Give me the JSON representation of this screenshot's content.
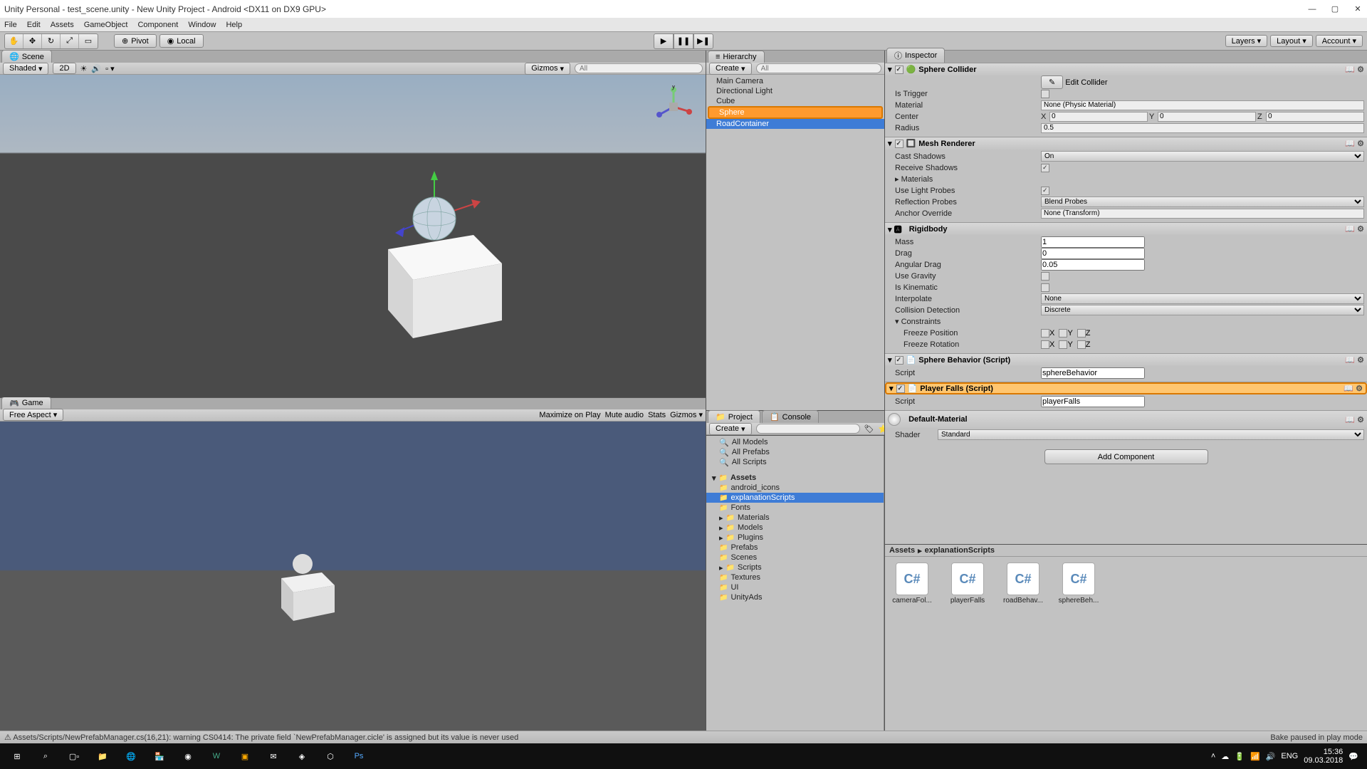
{
  "window": {
    "title": "Unity Personal - test_scene.unity - New Unity Project - Android <DX11 on DX9 GPU>",
    "min": "—",
    "max": "▢",
    "close": "✕"
  },
  "menu": [
    "File",
    "Edit",
    "Assets",
    "GameObject",
    "Component",
    "Window",
    "Help"
  ],
  "toolbar": {
    "pivot": "Pivot",
    "local": "Local",
    "layers": "Layers",
    "layout": "Layout",
    "account": "Account"
  },
  "scene": {
    "tab": "Scene",
    "shaded": "Shaded",
    "twoD": "2D",
    "gizmos": "Gizmos",
    "all": "All"
  },
  "game": {
    "tab": "Game",
    "aspect": "Free Aspect",
    "maximize": "Maximize on Play",
    "mute": "Mute audio",
    "stats": "Stats",
    "gizmos": "Gizmos"
  },
  "hierarchy": {
    "tab": "Hierarchy",
    "create": "Create",
    "all": "All",
    "items": [
      "Main Camera",
      "Directional Light",
      "Cube",
      "Sphere",
      "RoadContainer"
    ]
  },
  "inspector": {
    "tab": "Inspector",
    "sphereCollider": {
      "name": "Sphere Collider",
      "editCollider": "Edit Collider",
      "isTrigger": {
        "label": "Is Trigger"
      },
      "material": {
        "label": "Material",
        "value": "None (Physic Material)"
      },
      "center": {
        "label": "Center",
        "x": "0",
        "y": "0",
        "z": "0"
      },
      "radius": {
        "label": "Radius",
        "value": "0.5"
      }
    },
    "meshRenderer": {
      "name": "Mesh Renderer",
      "castShadows": {
        "label": "Cast Shadows",
        "value": "On"
      },
      "receiveShadows": {
        "label": "Receive Shadows"
      },
      "materials": {
        "label": "Materials"
      },
      "useLightProbes": {
        "label": "Use Light Probes"
      },
      "reflectionProbes": {
        "label": "Reflection Probes",
        "value": "Blend Probes"
      },
      "anchorOverride": {
        "label": "Anchor Override",
        "value": "None (Transform)"
      }
    },
    "rigidbody": {
      "name": "Rigidbody",
      "mass": {
        "label": "Mass",
        "value": "1"
      },
      "drag": {
        "label": "Drag",
        "value": "0"
      },
      "angularDrag": {
        "label": "Angular Drag",
        "value": "0.05"
      },
      "useGravity": {
        "label": "Use Gravity"
      },
      "isKinematic": {
        "label": "Is Kinematic"
      },
      "interpolate": {
        "label": "Interpolate",
        "value": "None"
      },
      "collisionDetection": {
        "label": "Collision Detection",
        "value": "Discrete"
      },
      "constraints": {
        "label": "Constraints"
      },
      "freezePos": {
        "label": "Freeze Position"
      },
      "freezeRot": {
        "label": "Freeze Rotation"
      }
    },
    "sphereBehavior": {
      "name": "Sphere Behavior (Script)",
      "script": {
        "label": "Script",
        "value": "sphereBehavior"
      }
    },
    "playerFalls": {
      "name": "Player Falls (Script)",
      "script": {
        "label": "Script",
        "value": "playerFalls"
      }
    },
    "material": {
      "name": "Default-Material",
      "shader": {
        "label": "Shader",
        "value": "Standard"
      }
    },
    "addComponent": "Add Component"
  },
  "project": {
    "tab": "Project",
    "console": "Console",
    "create": "Create",
    "favorites": [
      "All Models",
      "All Prefabs",
      "All Scripts"
    ],
    "assets_root": "Assets",
    "folders": [
      "android_icons",
      "explanationScripts",
      "Fonts",
      "Materials",
      "Models",
      "Plugins",
      "Prefabs",
      "Scenes",
      "Scripts",
      "Textures",
      "UI",
      "UnityAds"
    ],
    "breadcrumb": [
      "Assets",
      "explanationScripts"
    ],
    "files": [
      "cameraFol...",
      "playerFalls",
      "roadBehav...",
      "sphereBeh..."
    ]
  },
  "console_line": "Assets/Scripts/NewPrefabManager.cs(16,21): warning CS0414: The private field `NewPrefabManager.cicle' is assigned but its value is never used",
  "bake_status": "Bake paused in play mode",
  "taskbar": {
    "lang": "ENG",
    "time": "15:36",
    "date": "09.03.2018"
  }
}
